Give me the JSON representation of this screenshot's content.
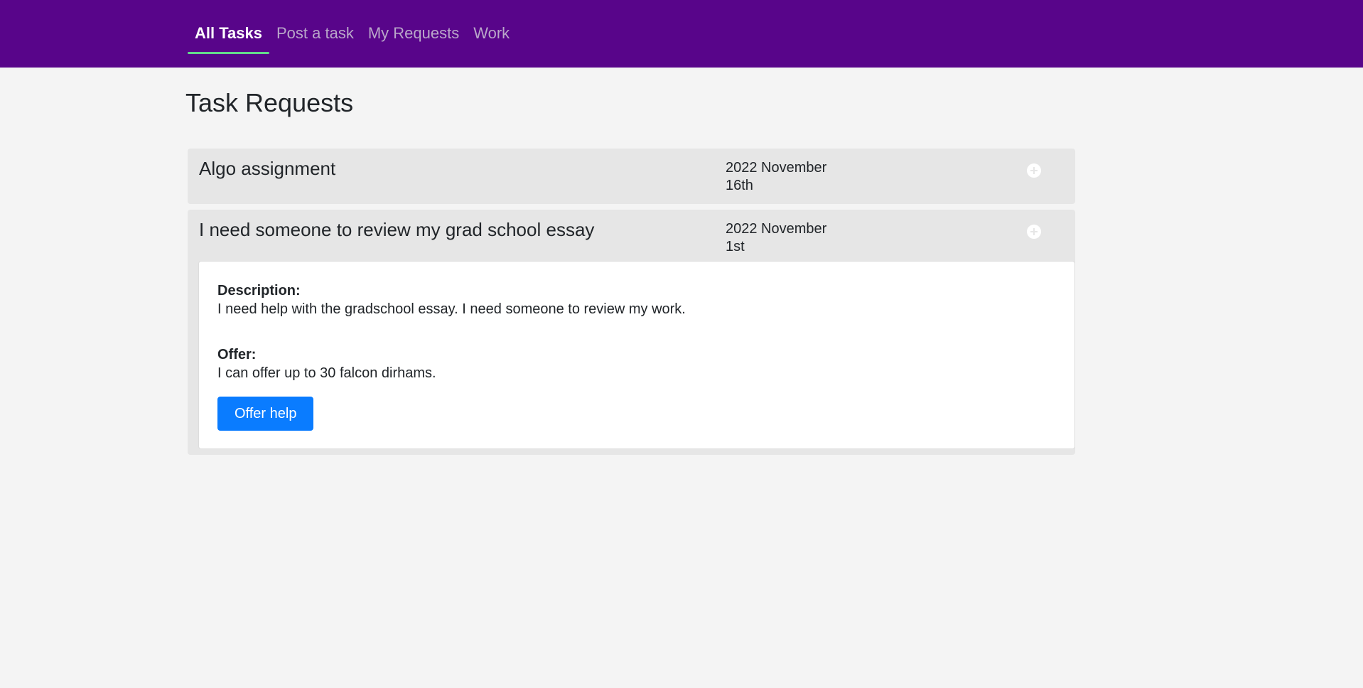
{
  "nav": {
    "items": [
      {
        "label": "All Tasks",
        "active": true
      },
      {
        "label": "Post a task",
        "active": false
      },
      {
        "label": "My Requests",
        "active": false
      },
      {
        "label": "Work",
        "active": false
      }
    ]
  },
  "page": {
    "title": "Task Requests"
  },
  "tasks": [
    {
      "title": "Algo assignment",
      "date_line1": "2022 November",
      "date_line2": "16th",
      "expanded": false,
      "toggle_icon": "plus-circle-icon"
    },
    {
      "title": "I need someone to review my grad school essay",
      "date_line1": "2022 November",
      "date_line2": "1st",
      "expanded": true,
      "toggle_icon": "plus-circle-icon",
      "description_label": "Description:",
      "description": "I need help with the gradschool essay. I need someone to review my work.",
      "offer_label": "Offer:",
      "offer": "I can offer up to 30 falcon dirhams.",
      "action_label": "Offer help"
    }
  ],
  "colors": {
    "navbar": "#58058a",
    "active_underline": "#64d98c",
    "button": "#0a7cff",
    "page_bg": "#f4f4f4",
    "card_bg": "#e6e6e6"
  }
}
